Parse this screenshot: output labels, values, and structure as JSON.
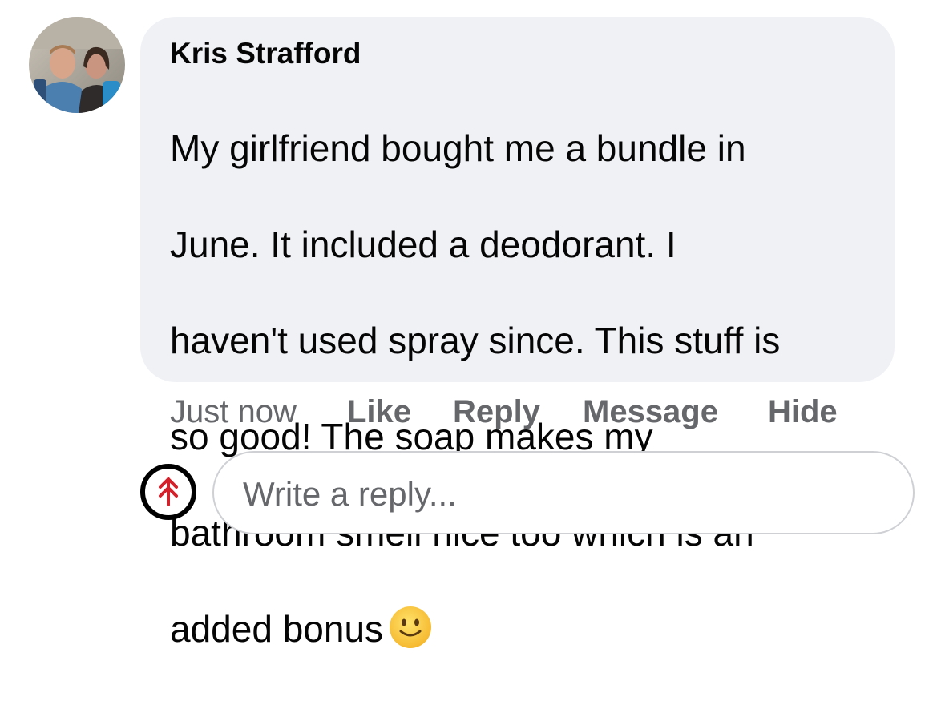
{
  "comment": {
    "author": "Kris Strafford",
    "lines": [
      "My girlfriend bought me a bundle in",
      "June. It included a deodorant.  I",
      "haven't used spray since.  This stuff is",
      "so good!  The soap makes my",
      "bathroom smell nice too which is an",
      "added bonus"
    ],
    "emoji": "slightly-smiling-face-icon"
  },
  "actions": {
    "timestamp": "Just now",
    "like": "Like",
    "reply": "Reply",
    "message": "Message",
    "hide": "Hide"
  },
  "reply_box": {
    "placeholder": "Write a reply..."
  },
  "colors": {
    "bubble": "#f0f1f5",
    "text": "#050505",
    "secondary": "#65676b",
    "brand_arrow": "#d4202a"
  }
}
